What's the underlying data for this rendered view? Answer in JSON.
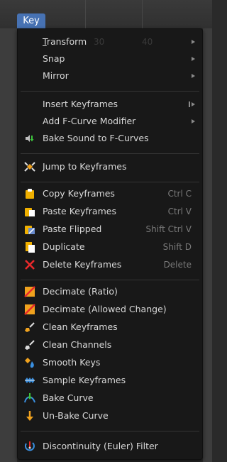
{
  "menu_tab": {
    "label": "Key"
  },
  "ghost_numbers": [
    "30",
    "40"
  ],
  "items": {
    "transform": "Transform",
    "snap": "Snap",
    "mirror": "Mirror",
    "insert_keyframes": "Insert Keyframes",
    "add_fcurve_modifier": "Add F-Curve Modifier",
    "bake_sound": "Bake Sound to F-Curves",
    "jump_to_keyframes": "Jump to Keyframes",
    "copy_keyframes": "Copy Keyframes",
    "copy_shortcut": "Ctrl C",
    "paste_keyframes": "Paste Keyframes",
    "paste_shortcut": "Ctrl V",
    "paste_flipped": "Paste Flipped",
    "paste_flipped_shortcut": "Shift Ctrl V",
    "duplicate": "Duplicate",
    "duplicate_shortcut": "Shift D",
    "delete_keyframes": "Delete Keyframes",
    "delete_shortcut": "Delete",
    "decimate_ratio": "Decimate (Ratio)",
    "decimate_allowed": "Decimate (Allowed Change)",
    "clean_keyframes": "Clean Keyframes",
    "clean_channels": "Clean Channels",
    "smooth_keys": "Smooth Keys",
    "sample_keyframes": "Sample Keyframes",
    "bake_curve": "Bake Curve",
    "unbake_curve": "Un-Bake Curve",
    "discontinuity_filter": "Discontinuity (Euler) Filter"
  },
  "colors": {
    "menu_bg": "#181818",
    "tab_bg": "#4772b3",
    "text": "#d9d9d9",
    "shortcut": "#7a7a7a"
  }
}
